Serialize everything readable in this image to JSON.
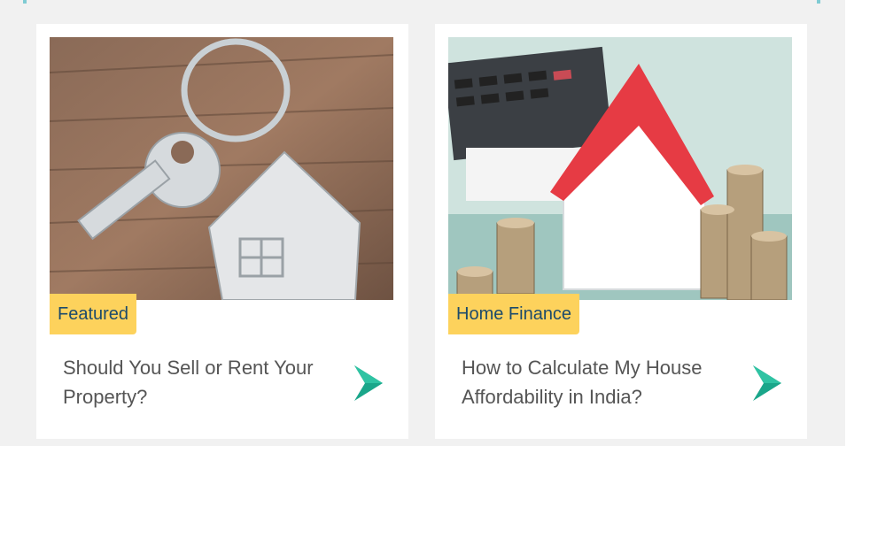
{
  "cards": [
    {
      "tag": "Featured",
      "title": "Should You Sell or Rent Your Property?",
      "image_subject": "house-keychain-image"
    },
    {
      "tag": "Home Finance",
      "title": "How to Calculate My House Affordability in India?",
      "image_subject": "house-model-coins-image"
    }
  ],
  "colors": {
    "tag_background": "#fdd25c",
    "tag_text": "#1c4a6b",
    "arrow": "#1aa68a",
    "section_background": "#f1f1f1",
    "card_background": "#ffffff"
  },
  "icons": {
    "next": "arrow-right-icon"
  }
}
